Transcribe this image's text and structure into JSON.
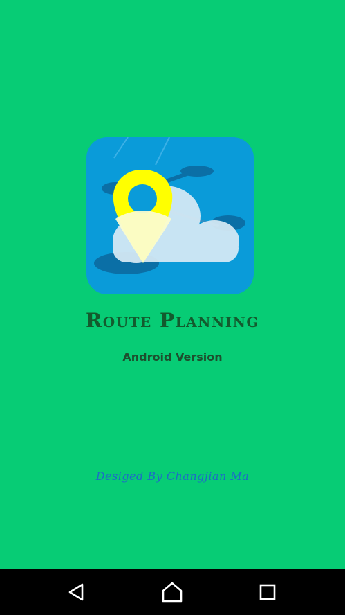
{
  "splash": {
    "background_color": "#07cc75",
    "logo_icon": "route-planning-logo-icon",
    "title": "Route Planning",
    "subtitle": "Android Version",
    "credit": "Desiged By Changjian Ma"
  },
  "navbar": {
    "background_color": "#000000",
    "buttons": [
      {
        "icon": "back-triangle-icon"
      },
      {
        "icon": "home-icon"
      },
      {
        "icon": "recents-square-icon"
      }
    ]
  }
}
